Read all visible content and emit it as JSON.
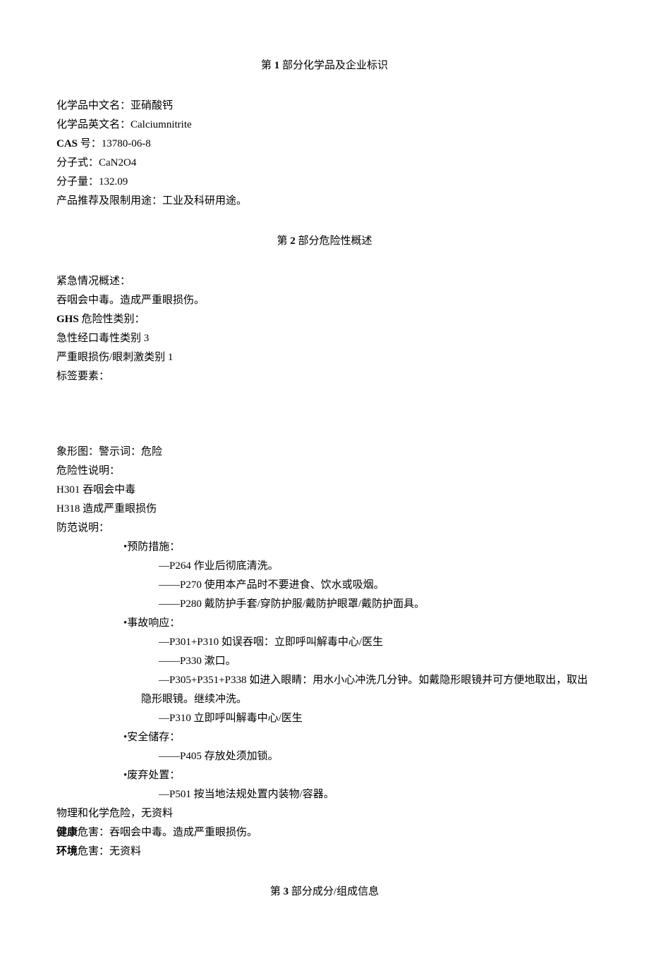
{
  "section1": {
    "header_prefix": "第 ",
    "header_num": "1",
    "header_suffix": " 部分化学品及企业标识",
    "name_cn_label": "化学品中文名：",
    "name_cn": "亚硝酸钙",
    "name_en_label": "化学品英文名：",
    "name_en": "Calciumnitrite",
    "cas_label": "CAS",
    "cas_suffix": " 号：",
    "cas": "13780-06-8",
    "formula_label": "分子式：",
    "formula": "CaN2O4",
    "mw_label": "分子量：",
    "mw": "132.09",
    "use_label": "产品推荐及限制用途：",
    "use": "工业及科研用途。"
  },
  "section2": {
    "header_prefix": "第 ",
    "header_num": "2",
    "header_suffix": " 部分危险性概述",
    "emergency_label": "紧急情况概述：",
    "emergency": "吞咽会中毒。造成严重眼损伤。",
    "ghs_label": "GHS",
    "ghs_suffix": " 危险性类别：",
    "ghs_cat1": "急性经口毒性类别 3",
    "ghs_cat2": "严重眼损伤/眼刺激类别 1",
    "label_elements": "标签要素：",
    "pictogram": "象形图：警示词：危险",
    "hazard_statement_label": "危险性说明：",
    "h301": "H301 吞咽会中毒",
    "h318": "H318 造成严重眼损伤",
    "precaution_label": "防范说明：",
    "prevention_label": "•预防措施：",
    "p264": "—P264 作业后彻底清洗。",
    "p270": "——P270 使用本产品时不要进食、饮水或吸烟。",
    "p280": "——P280 戴防护手套/穿防护服/戴防护眼罩/戴防护面具。",
    "response_label": "•事故响应：",
    "p301p310": "—P301+P310 如误吞咽：立即呼叫解毒中心/医生",
    "p330": "——P330 漱口。",
    "p305": "—P305+P351+P338 如进入眼睛：用水小心冲洗几分钟。如戴隐形眼镜并可方便地取出，取出",
    "p305_cont": "隐形眼镜。继续冲洗。",
    "p310": "—P310 立即呼叫解毒中心/医生",
    "storage_label": "•安全储存：",
    "p405": "——P405 存放处须加锁。",
    "disposal_label": "•废弃处置：",
    "p501": "—P501 按当地法规处置内装物/容器。",
    "phys_chem": "物理和化学危险，无资料",
    "health_label": "健康",
    "health": "危害：吞咽会中毒。造成严重眼损伤。",
    "env_label": "环境",
    "env": "危害：无资料"
  },
  "section3": {
    "header_prefix": "第 ",
    "header_num": "3",
    "header_suffix": " 部分成分/组成信息"
  }
}
